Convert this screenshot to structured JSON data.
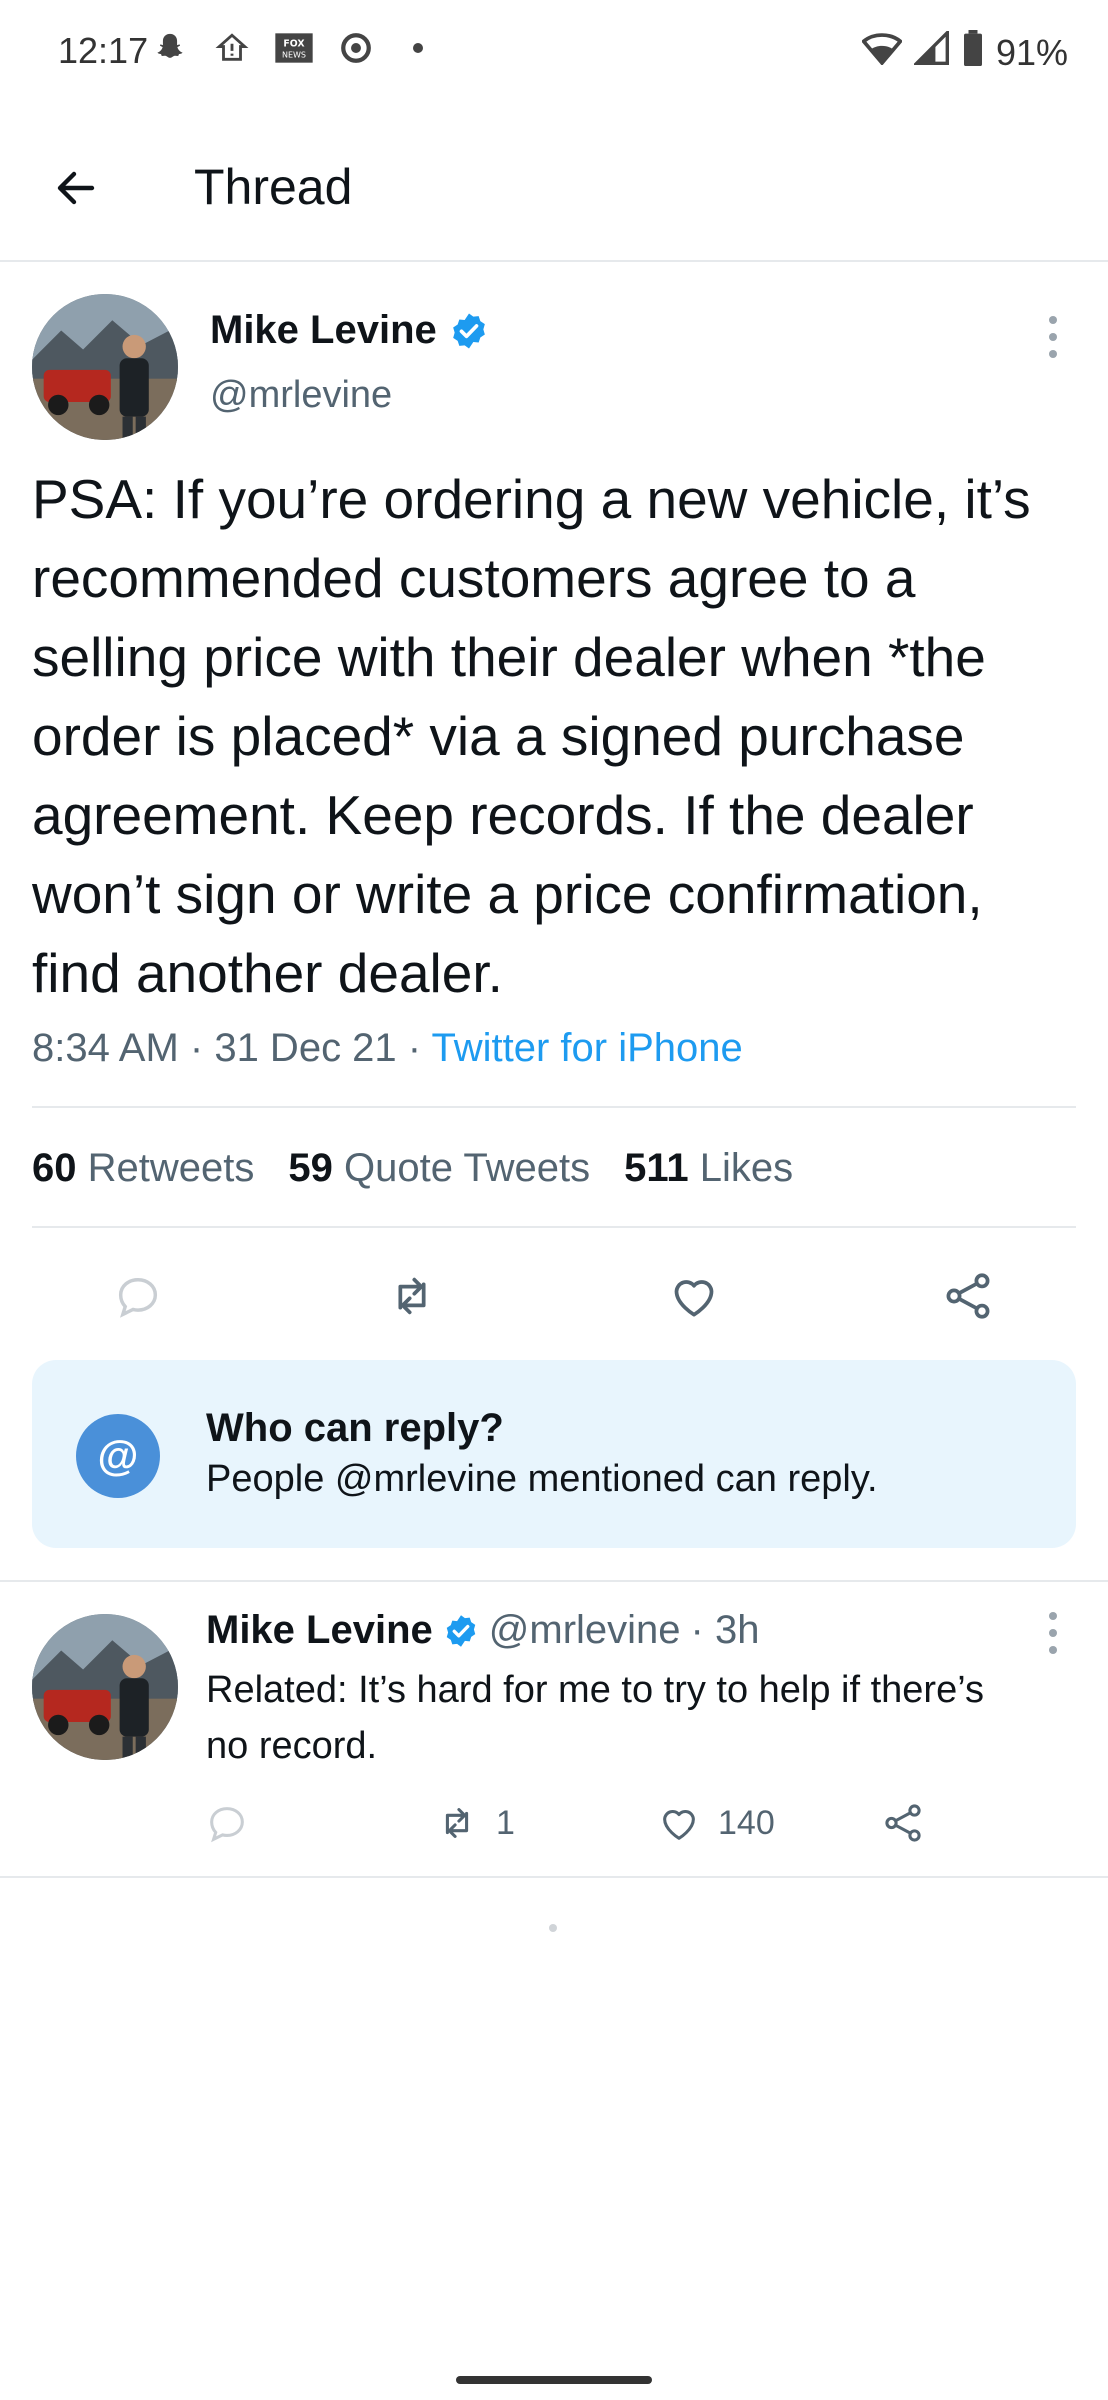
{
  "status_bar": {
    "time": "12:17",
    "battery": "91%",
    "left_icons": [
      "snapchat-icon",
      "home-alert-icon",
      "fox-news-icon",
      "circle-app-icon",
      "dot-icon"
    ],
    "right_icons": [
      "wifi-icon",
      "signal-icon",
      "battery-icon"
    ]
  },
  "header": {
    "title": "Thread"
  },
  "main_tweet": {
    "name": "Mike Levine",
    "handle": "@mrlevine",
    "text": "PSA: If you’re ordering a new vehicle, it’s recommended customers agree to a selling price with their dealer when *the order is placed* via a signed purchase agreement. Keep records. If the dealer won’t sign or write a price confirmation, find another dealer.",
    "time": "8:34 AM",
    "date": "31 Dec 21",
    "source": "Twitter for iPhone",
    "stats": {
      "retweets_count": "60",
      "retweets_label": "Retweets",
      "quotes_count": "59",
      "quotes_label": "Quote Tweets",
      "likes_count": "511",
      "likes_label": "Likes"
    }
  },
  "reply_restriction": {
    "badge": "@",
    "title": "Who can reply?",
    "subtitle": "People @mrlevine mentioned can reply."
  },
  "reply_tweet": {
    "name": "Mike Levine",
    "handle": "@mrlevine",
    "age": "· 3h",
    "text": "Related: It’s hard for me to try to help if there’s no record.",
    "retweets": "1",
    "likes": "140"
  },
  "colors": {
    "accent": "#1d9bf0",
    "verified": "#1d9bf0",
    "reply_box_bg": "#e8f5fd",
    "at_badge": "#4a90d9",
    "muted_text": "#536471"
  }
}
